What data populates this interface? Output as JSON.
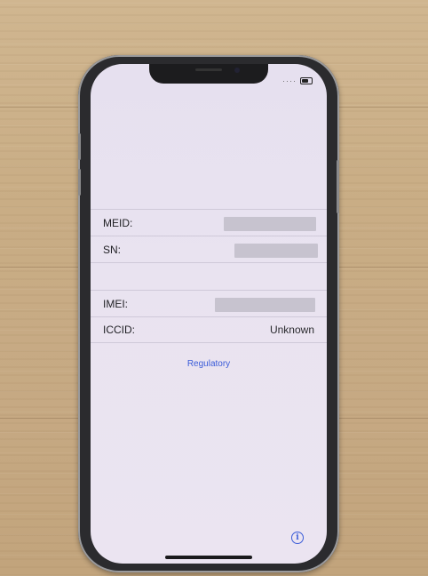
{
  "device_info": {
    "rows": [
      {
        "label": "MEID:",
        "value": ""
      },
      {
        "label": "SN:",
        "value": ""
      },
      {
        "label": "IMEI:",
        "value": ""
      },
      {
        "label": "ICCID:",
        "value": "Unknown"
      }
    ]
  },
  "links": {
    "regulatory": "Regulatory"
  },
  "icons": {
    "info": "info-icon",
    "battery": "battery-icon"
  },
  "colors": {
    "link": "#3a5bd8",
    "screen_bg": "#e8e2f0"
  }
}
